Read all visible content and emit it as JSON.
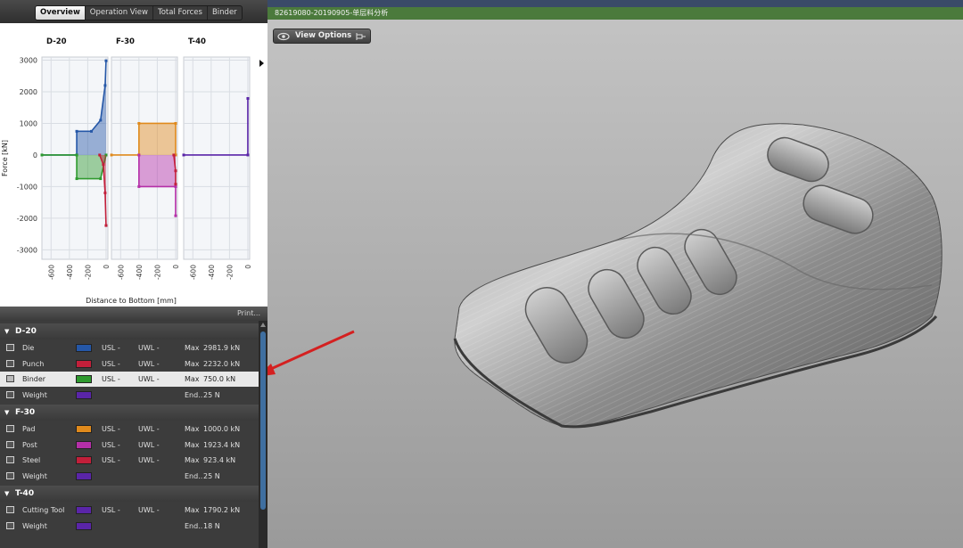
{
  "tabs": [
    "Overview",
    "Operation View",
    "Total Forces",
    "Binder"
  ],
  "active_tab": 0,
  "chart_data": {
    "type": "area",
    "ylabel": "Force [kN]",
    "xlabel": "Distance to Bottom [mm]",
    "ylim": [
      -3300,
      3100
    ],
    "yticks": [
      3000,
      2000,
      1000,
      0,
      -1000,
      -2000,
      -3000
    ],
    "xticks": [
      -600,
      -400,
      -200,
      0
    ],
    "xlim": [
      -700,
      20
    ],
    "grid": true,
    "panels": [
      {
        "title": "D-20",
        "series": [
          {
            "name": "Die",
            "color": "#2557a7",
            "x": [
              -700,
              -320,
              -320,
              -160,
              -60,
              -10,
              0
            ],
            "y": [
              0,
              0,
              750,
              750,
              1100,
              2200,
              2982
            ]
          },
          {
            "name": "Binder",
            "color": "#2e9a2e",
            "x": [
              -700,
              -320,
              -320,
              -60,
              0
            ],
            "y": [
              0,
              0,
              -750,
              -750,
              0
            ]
          },
          {
            "name": "Punch",
            "color": "#c21f3a",
            "x": [
              -70,
              -30,
              -10,
              0
            ],
            "y": [
              0,
              -300,
              -1200,
              -2232
            ]
          }
        ]
      },
      {
        "title": "F-30",
        "series": [
          {
            "name": "Pad",
            "color": "#e08a1c",
            "x": [
              -700,
              -400,
              -400,
              0,
              0
            ],
            "y": [
              0,
              0,
              1000,
              1000,
              0
            ]
          },
          {
            "name": "Post",
            "color": "#b52fa8",
            "x": [
              -400,
              -400,
              0,
              0
            ],
            "y": [
              0,
              -1000,
              -1000,
              -1923
            ]
          },
          {
            "name": "Steel",
            "color": "#c21f3a",
            "x": [
              -20,
              0,
              0
            ],
            "y": [
              0,
              -500,
              -923
            ]
          }
        ]
      },
      {
        "title": "T-40",
        "series": [
          {
            "name": "Cutting Tool",
            "color": "#5a25a8",
            "x": [
              -700,
              0,
              0
            ],
            "y": [
              0,
              0,
              1790
            ]
          }
        ]
      }
    ]
  },
  "print_label": "Print...",
  "groups": [
    {
      "name": "D-20",
      "items": [
        {
          "label": "Die",
          "color": "#2557a7",
          "usl": "USL  -",
          "uwl": "UWL  -",
          "max_label": "Max",
          "max": "2981.9 kN"
        },
        {
          "label": "Punch",
          "color": "#c21f3a",
          "usl": "USL  -",
          "uwl": "UWL  -",
          "max_label": "Max",
          "max": "2232.0 kN"
        },
        {
          "label": "Binder",
          "color": "#2e9a2e",
          "usl": "USL  -",
          "uwl": "UWL  -",
          "max_label": "Max",
          "max": "750.0 kN",
          "highlight": true
        },
        {
          "label": "Weight",
          "color": "#5a25a8",
          "usl": "",
          "uwl": "",
          "max_label": "End..",
          "max": "25 N"
        }
      ]
    },
    {
      "name": "F-30",
      "items": [
        {
          "label": "Pad",
          "color": "#e08a1c",
          "usl": "USL  -",
          "uwl": "UWL  -",
          "max_label": "Max",
          "max": "1000.0 kN"
        },
        {
          "label": "Post",
          "color": "#b52fa8",
          "usl": "USL  -",
          "uwl": "UWL  -",
          "max_label": "Max",
          "max": "1923.4 kN"
        },
        {
          "label": "Steel",
          "color": "#c21f3a",
          "usl": "USL  -",
          "uwl": "UWL  -",
          "max_label": "Max",
          "max": "923.4 kN"
        },
        {
          "label": "Weight",
          "color": "#5a25a8",
          "usl": "",
          "uwl": "",
          "max_label": "End..",
          "max": "25 N"
        }
      ]
    },
    {
      "name": "T-40",
      "items": [
        {
          "label": "Cutting Tool",
          "color": "#5a25a8",
          "usl": "USL  -",
          "uwl": "UWL  -",
          "max_label": "Max",
          "max": "1790.2 kN"
        },
        {
          "label": "Weight",
          "color": "#5a25a8",
          "usl": "",
          "uwl": "",
          "max_label": "End..",
          "max": "18 N"
        }
      ]
    }
  ],
  "viewport": {
    "title": "82619080-20190905-单层料分析",
    "view_options_label": "View Options",
    "background_color": "#b3b3b3"
  },
  "annotation_color": "#d42020"
}
